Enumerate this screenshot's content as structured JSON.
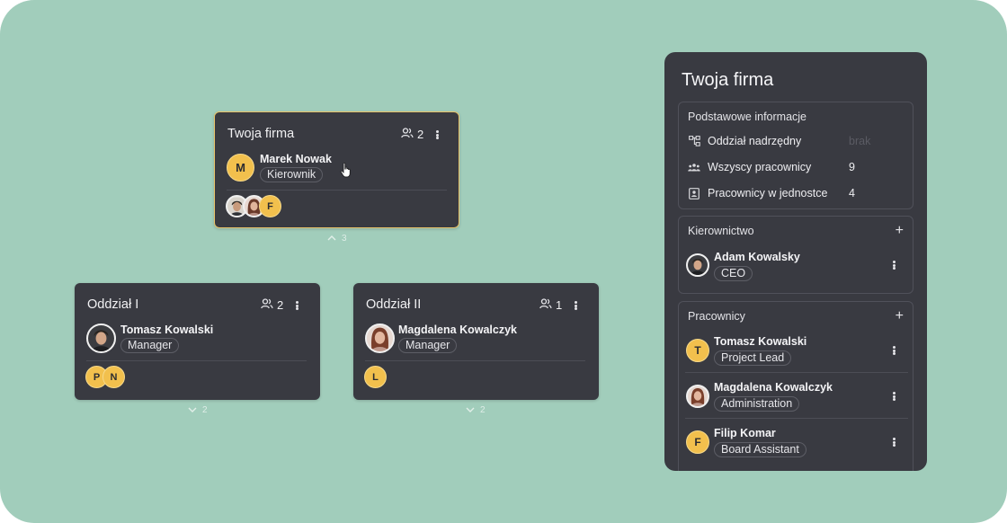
{
  "org": {
    "root": {
      "title": "Twoja firma",
      "members_count": "2",
      "manager": {
        "name": "Marek Nowak",
        "role": "Kierownik",
        "initial": "M"
      },
      "member_avatars": [
        {
          "type": "photo-male"
        },
        {
          "type": "photo-female"
        },
        {
          "type": "initial",
          "initial": "F"
        }
      ],
      "children_count": "3"
    },
    "unit1": {
      "title": "Oddział I",
      "members_count": "2",
      "manager": {
        "name": "Tomasz Kowalski",
        "role": "Manager"
      },
      "member_initials": [
        "P",
        "N"
      ],
      "children_count": "2"
    },
    "unit2": {
      "title": "Oddział II",
      "members_count": "1",
      "manager": {
        "name": "Magdalena Kowalczyk",
        "role": "Manager"
      },
      "member_initials": [
        "L"
      ],
      "children_count": "2"
    }
  },
  "panel": {
    "title": "Twoja firma",
    "basic": {
      "title": "Podstawowe informacje",
      "rows": [
        {
          "label": "Oddział nadrzędny",
          "value": "brak",
          "icon": "hierarchy-icon"
        },
        {
          "label": "Wszyscy pracownicy",
          "value": "9",
          "icon": "group-icon"
        },
        {
          "label": "Pracownicy w jednostce",
          "value": "4",
          "icon": "badge-icon"
        }
      ]
    },
    "management": {
      "title": "Kierownictwo",
      "people": [
        {
          "name": "Adam Kowalsky",
          "role": "CEO"
        }
      ]
    },
    "employees": {
      "title": "Pracownicy",
      "people": [
        {
          "name": "Tomasz Kowalski",
          "role": "Project Lead",
          "initial": "T"
        },
        {
          "name": "Magdalena Kowalczyk",
          "role": "Administration"
        },
        {
          "name": "Filip Komar",
          "role": "Board Assistant",
          "initial": "F"
        }
      ]
    }
  },
  "colors": {
    "background": "#a1cdbb",
    "card": "#393a41",
    "accent": "#f2c04d",
    "selected_border": "#e9c46a"
  }
}
